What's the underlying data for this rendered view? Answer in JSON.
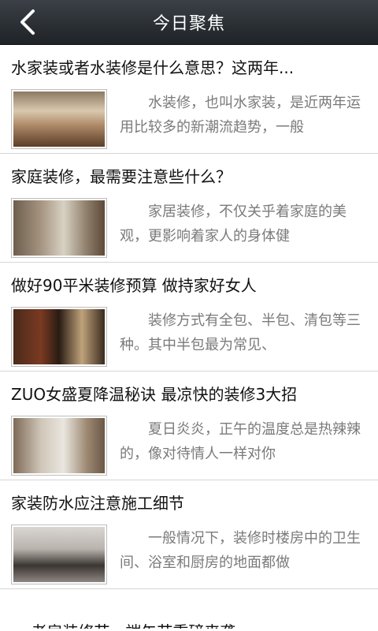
{
  "header": {
    "title": "今日聚焦",
    "back_icon": "chevron-left-icon"
  },
  "articles": [
    {
      "title": "水家装或者水装修是什么意思？这两年...",
      "summary": "水装修，也叫水家装，是近两年运用比较多的新潮流趋势，一般"
    },
    {
      "title": "家庭装修，最需要注意些什么？",
      "summary": "家居装修，不仅关乎着家庭的美观，更影响着家人的身体健"
    },
    {
      "title": "做好90平米装修预算 做持家好女人",
      "summary": "装修方式有全包、半包、清包等三种。其中半包最为常见、"
    },
    {
      "title": "ZUO女盛夏降温秘诀 最凉快的装修3大招",
      "summary": "夏日炎炎，正午的温度总是热辣辣的，像对待情人一样对你"
    },
    {
      "title": "家装防水应注意施工细节",
      "summary": "一般情况下，装修时楼房中的卫生间、浴室和厨房的地面都做"
    }
  ],
  "partial_article": {
    "title": "老房装修节　端午节重磅来袭"
  }
}
